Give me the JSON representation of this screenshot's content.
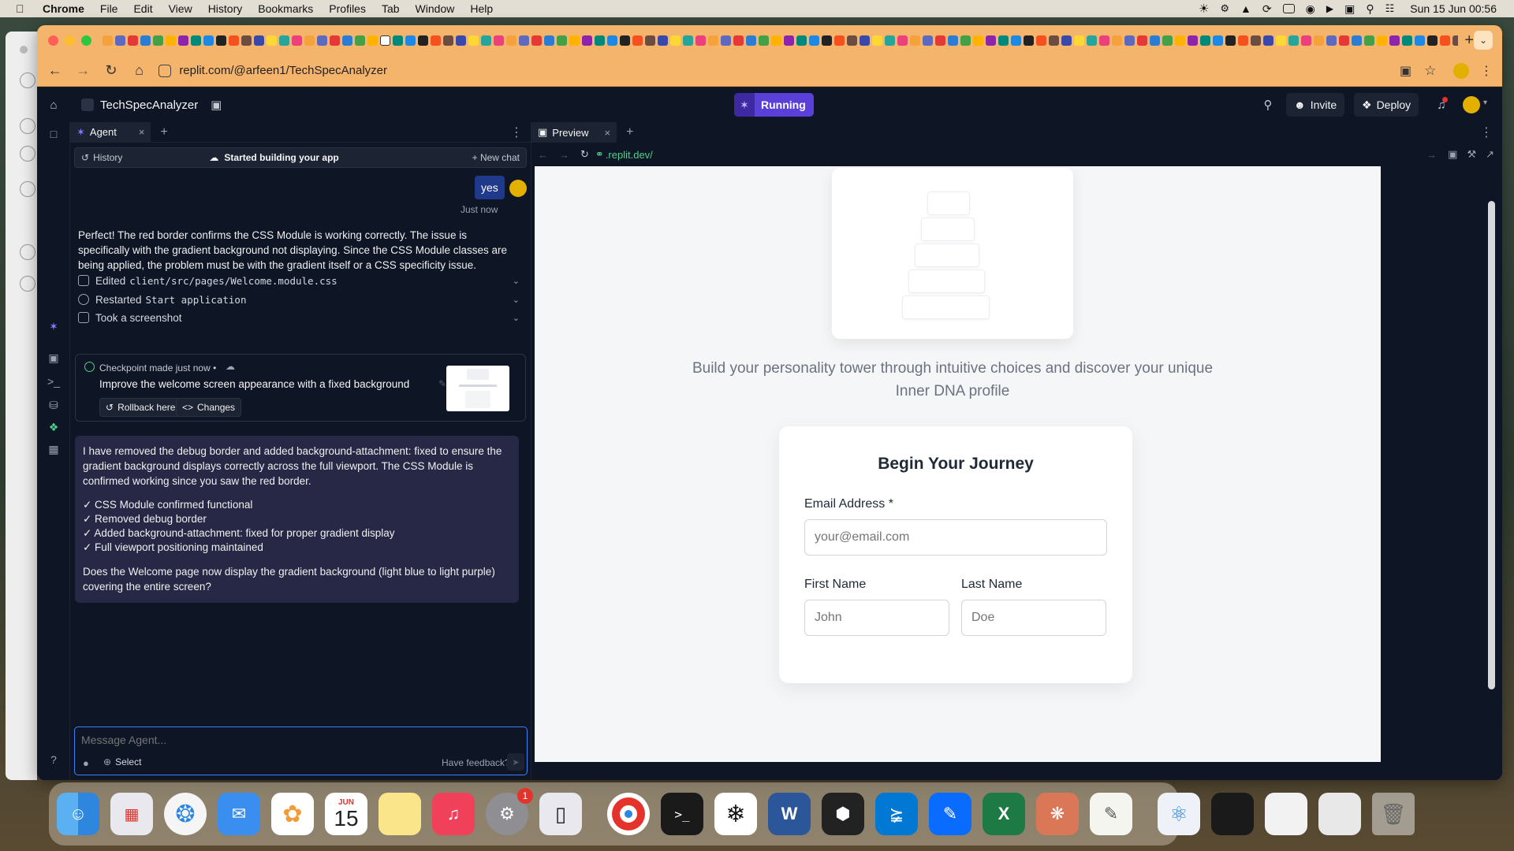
{
  "menubar": {
    "app": "Chrome",
    "items": [
      "File",
      "Edit",
      "View",
      "History",
      "Bookmarks",
      "Profiles",
      "Tab",
      "Window",
      "Help"
    ],
    "datetime": "Sun 15 Jun  00:56"
  },
  "browser": {
    "url": "replit.com/@arfeen1/TechSpecAnalyzer",
    "tab_colors": [
      "#f6a23c",
      "#5c6bc0",
      "#e53935",
      "#2b7cd3",
      "#43a047",
      "#ffb300",
      "#8e24aa",
      "#00897b",
      "#1e88e5",
      "#222222",
      "#f4511e",
      "#6d4c41",
      "#3949ab",
      "#fdd835",
      "#26a69a",
      "#ec407a"
    ]
  },
  "replit": {
    "project": "TechSpecAnalyzer",
    "run_label": "Running",
    "invite_label": "Invite",
    "deploy_label": "Deploy"
  },
  "agent": {
    "tab_label": "Agent",
    "history_label": "History",
    "status": "Started building your app",
    "new_chat": "New chat",
    "user_message": "yes",
    "timestamp": "Just now",
    "message1": "Perfect! The red border confirms the CSS Module is working correctly. The issue is specifically with the gradient background not displaying. Since the CSS Module classes are being applied, the problem must be with the gradient itself or a CSS specificity issue.",
    "actions": [
      {
        "label": "Edited",
        "code": "client/src/pages/Welcome.module.css"
      },
      {
        "label": "Restarted",
        "code": "Start application"
      },
      {
        "label": "Took a screenshot",
        "code": ""
      }
    ],
    "checkpoint": {
      "title": "Checkpoint made just now •",
      "description": "Improve the welcome screen appearance with a fixed background",
      "rollback": "Rollback here",
      "changes": "Changes"
    },
    "message2": {
      "intro": "I have removed the debug border and added background-attachment: fixed to ensure the gradient background displays correctly across the full viewport. The CSS Module is confirmed working since you saw the red border.",
      "checks": [
        "✓ CSS Module confirmed functional",
        "✓ Removed debug border",
        "✓ Added background-attachment: fixed for proper gradient display",
        "✓ Full viewport positioning maintained"
      ],
      "question": "Does the Welcome page now display the gradient background (light blue to light purple) covering the entire screen?"
    },
    "composer": {
      "placeholder": "Message Agent...",
      "select": "Select",
      "feedback": "Have feedback?"
    }
  },
  "preview": {
    "tab_label": "Preview",
    "url": ".replit.dev/",
    "tagline": "Build your personality tower through intuitive choices and discover your unique Inner DNA profile",
    "form": {
      "title": "Begin Your Journey",
      "email_label": "Email Address *",
      "email_placeholder": "your@email.com",
      "first_label": "First Name",
      "first_placeholder": "John",
      "last_label": "Last Name",
      "last_placeholder": "Doe"
    }
  },
  "dock": {
    "calendar_month": "JUN",
    "calendar_day": "15",
    "settings_badge": "1"
  }
}
